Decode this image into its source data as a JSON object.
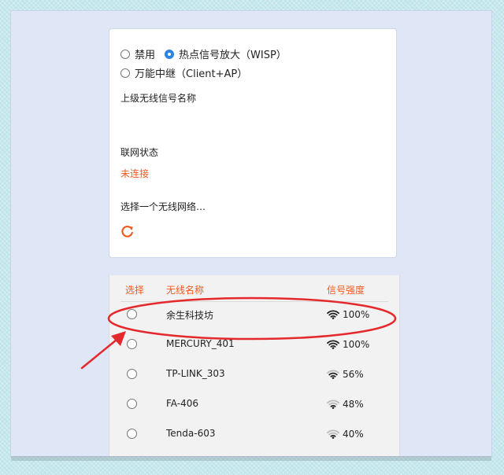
{
  "modes": {
    "disable_label": "禁用",
    "wisp_label": "热点信号放大（WISP）",
    "universal_label": "万能中继（Client+AP）"
  },
  "upstream": {
    "label": "上级无线信号名称"
  },
  "connection": {
    "label": "联网状态",
    "status": "未连接"
  },
  "select_network": {
    "label": "选择一个无线网络…"
  },
  "table": {
    "headers": {
      "select": "选择",
      "name": "无线名称",
      "signal": "信号强度"
    },
    "rows": [
      {
        "name": "余生科技坊",
        "signal": "100%",
        "bars": 4
      },
      {
        "name": "MERCURY_401",
        "signal": "100%",
        "bars": 4
      },
      {
        "name": "TP-LINK_303",
        "signal": "56%",
        "bars": 3
      },
      {
        "name": "FA-406",
        "signal": "48%",
        "bars": 2
      },
      {
        "name": "Tenda-603",
        "signal": "40%",
        "bars": 2
      }
    ]
  },
  "colors": {
    "accent": "#2b84e7",
    "status_red": "#f05a1f",
    "annotation_red": "#e5282c"
  },
  "icons": {
    "refresh": "refresh-icon",
    "wifi": "wifi-signal-icon"
  }
}
